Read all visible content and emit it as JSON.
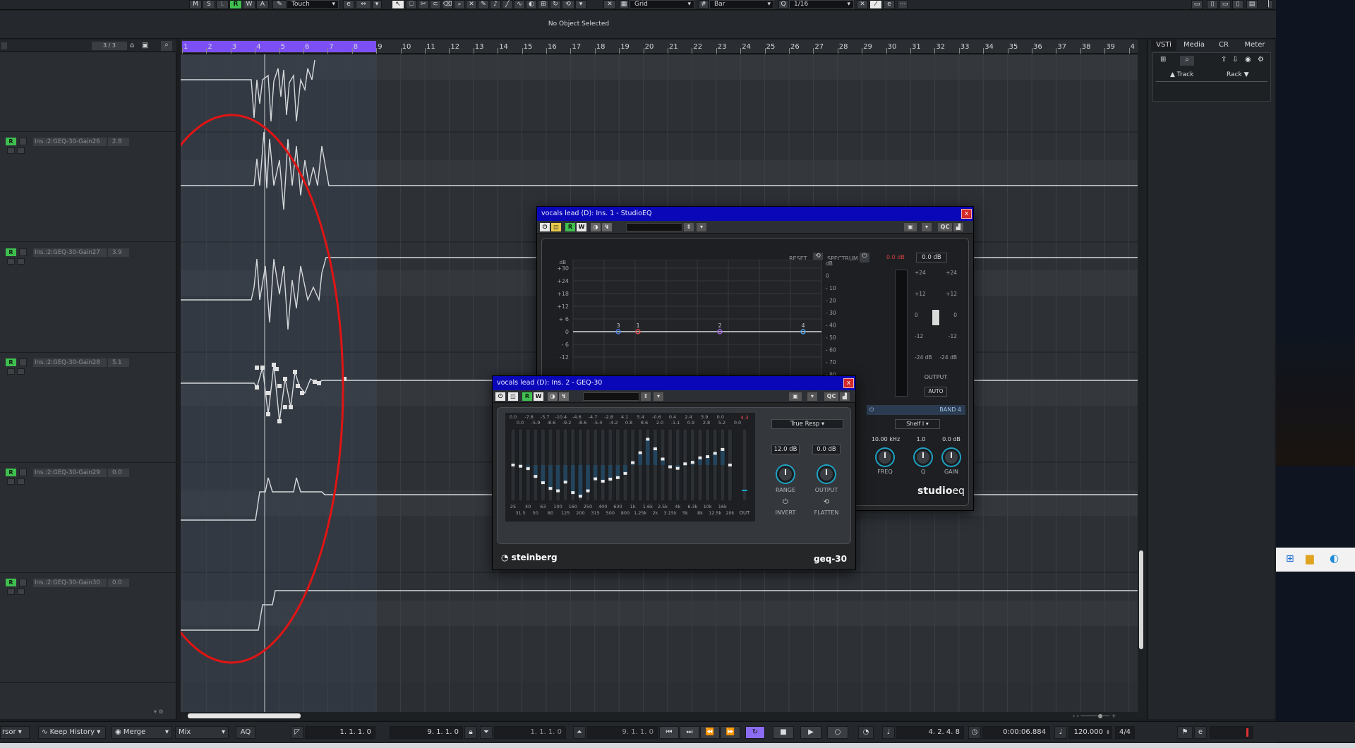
{
  "toolbar": {
    "buttons": [
      "M",
      "S",
      "L",
      "R",
      "W",
      "A"
    ],
    "automation_mode": "Touch",
    "snap_type": "Grid",
    "grid_type": "Bar",
    "quantize": "1/16"
  },
  "infoline": {
    "text": "No Object Selected"
  },
  "tracklist": {
    "count": "3 / 3",
    "lanes": [
      {
        "name": "Ins.:2:GEQ-30-Gain26",
        "value": "2.8",
        "read": "R"
      },
      {
        "name": "Ins.:2:GEQ-30-Gain27",
        "value": "3.9",
        "read": "R"
      },
      {
        "name": "Ins.:2:GEQ-30-Gain28",
        "value": "5.1",
        "read": "R"
      },
      {
        "name": "Ins.:2:GEQ-30-Gain29",
        "value": "0.0",
        "read": "R"
      },
      {
        "name": "Ins.:2:GEQ-30-Gain30",
        "value": "0.0",
        "read": "R"
      }
    ]
  },
  "ruler": {
    "bars": [
      "1",
      "2",
      "3",
      "4",
      "5",
      "6",
      "7",
      "8",
      "9",
      "10",
      "11",
      "12",
      "13",
      "14",
      "15",
      "16",
      "17",
      "18",
      "19",
      "20",
      "21",
      "22",
      "23",
      "24",
      "25",
      "26",
      "27",
      "28",
      "29",
      "30",
      "31",
      "32",
      "33",
      "34",
      "35",
      "36",
      "37",
      "38",
      "39",
      "4"
    ]
  },
  "rightzone": {
    "tabs": [
      "VSTi",
      "Media",
      "CR",
      "Meter"
    ],
    "track_label": "Track",
    "rack_label": "Rack"
  },
  "studioeq": {
    "title": "vocals lead (D): Ins. 1 - StudioEQ",
    "close": "x",
    "btn_r": "R",
    "btn_w": "W",
    "btn_qc": "QC",
    "reset_label": "RESET",
    "spectrum_label": "SPECTRUM",
    "db_axis_label": "dB",
    "db_left": [
      "+30",
      "+24",
      "+18",
      "+12",
      "+ 6",
      "0",
      "- 6",
      "-12"
    ],
    "db_right": [
      "dB",
      "0",
      "- 10",
      "- 20",
      "- 30",
      "- 40",
      "- 50",
      "- 60",
      "- 70",
      "- 80",
      "- 90"
    ],
    "nodes": [
      "3",
      "1",
      "2",
      "4"
    ],
    "peak_readout": "0.0 dB",
    "output_value": "0.0 dB",
    "output_label": "OUTPUT",
    "output_scale": [
      "+24",
      "+12",
      "0",
      "-12",
      "-24 dB"
    ],
    "auto_label": "AUTO",
    "band_label": "BAND 4",
    "shelf_type": "Shelf I",
    "freq_value": "10.00 kHz",
    "q_value": "1.0",
    "gain_value": "0.0 dB",
    "freq_label": "FREQ",
    "q_label": "Q",
    "gain_label": "GAIN",
    "logo_text": "studio",
    "logo_text2": "eq"
  },
  "geq30": {
    "title": "vocals lead (D): Ins. 2 - GEQ-30",
    "close": "x",
    "btn_r": "R",
    "btn_w": "W",
    "btn_qc": "QC",
    "gain_row1": [
      "0.0",
      "-7.8",
      "-5.7",
      "-10.4",
      "-4.6",
      "-4.7",
      "-2.8",
      "4.1",
      "5.4",
      "-0.6",
      "0.4",
      "2.4",
      "3.9",
      "0.0"
    ],
    "gain_row2": [
      "0.0",
      "-5.9",
      "-8.6",
      "-9.2",
      "-8.6",
      "-5.4",
      "-4.2",
      "0.8",
      "8.6",
      "2.0",
      "-1.1",
      "0.9",
      "2.8",
      "5.2",
      "0.0"
    ],
    "peak_label": "4.3",
    "band_gains": [
      0.0,
      -0.4,
      -1.2,
      -3.8,
      -5.9,
      -7.8,
      -8.6,
      -5.7,
      -9.2,
      -10.4,
      -8.6,
      -4.6,
      -5.4,
      -4.7,
      -4.2,
      -2.8,
      0.8,
      4.1,
      8.6,
      5.4,
      2.0,
      -0.6,
      -1.1,
      0.4,
      0.9,
      2.4,
      2.8,
      3.9,
      5.2,
      0.0
    ],
    "freq_row1": [
      "25",
      "40",
      "63",
      "100",
      "160",
      "250",
      "400",
      "630",
      "1k",
      "1.6k",
      "2.5k",
      "4k",
      "6.3k",
      "10k",
      "16k"
    ],
    "freq_row2": [
      "31.5",
      "50",
      "80",
      "125",
      "200",
      "315",
      "500",
      "800",
      "1.25k",
      "2k",
      "3.15k",
      "5k",
      "8k",
      "12.5k",
      "20k"
    ],
    "out_label": "OUT",
    "mode": "True Resp",
    "range_value": "12.0 dB",
    "output_value": "0.0 dB",
    "range_label": "RANGE",
    "output_label": "OUTPUT",
    "invert_label": "INVERT",
    "flatten_label": "FLATTEN",
    "brand": "steinberg",
    "logo": "geq-30"
  },
  "transport": {
    "tool": "rsor",
    "keep_history": "Keep History",
    "merge": "Merge",
    "mix": "Mix",
    "aq": "AQ",
    "left_locator": "1. 1. 1.   0",
    "right_locator": "9. 1. 1.   0",
    "punch_in": "1. 1. 1.   0",
    "punch_out": "9. 1. 1.   0",
    "position_bars": "4. 2. 4.   8",
    "position_time": "0:00:06.884",
    "tempo": "120.000",
    "signature": "4/4"
  }
}
